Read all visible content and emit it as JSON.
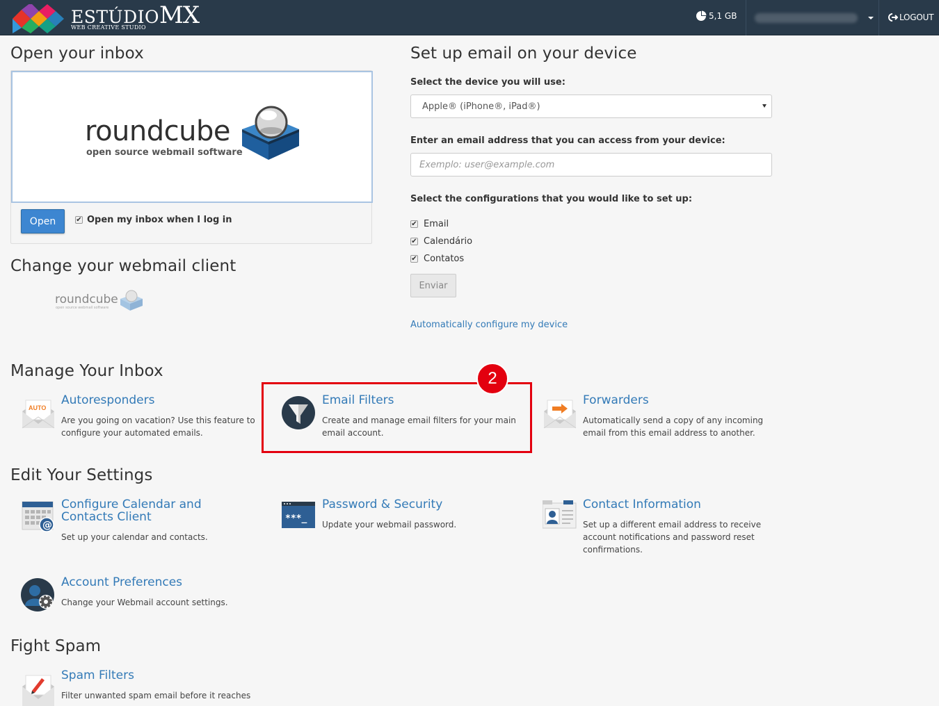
{
  "header": {
    "brand_main": "ESTÚDIO",
    "brand_mx": "MX",
    "brand_tagline": "WEB CREATIVE STUDIO",
    "disk_usage": "5,1 GB",
    "logout_label": "LOGOUT"
  },
  "inbox": {
    "title": "Open your inbox",
    "client_name": "roundcube",
    "client_tagline": "open source webmail software",
    "open_button": "Open",
    "auto_open_label": "Open my inbox when I log in"
  },
  "webmail_client": {
    "title": "Change your webmail client",
    "client_name": "roundcube",
    "client_tagline": "open source webmail software"
  },
  "device_setup": {
    "title": "Set up email on your device",
    "device_label": "Select the device you will use:",
    "device_selected": "Apple® (iPhone®, iPad®)",
    "email_label": "Enter an email address that you can access from your device:",
    "email_placeholder": "Exemplo: user@example.com",
    "configs_label": "Select the configurations that you would like to set up:",
    "configs": [
      "Email",
      "Calendário",
      "Contatos"
    ],
    "submit_button": "Enviar",
    "auto_configure_link": "Automatically configure my device"
  },
  "manage_inbox": {
    "title": "Manage Your Inbox",
    "items": [
      {
        "title": "Autoresponders",
        "desc": "Are you going on vacation? Use this feature to configure your automated emails.",
        "icon_text": "AUTO"
      },
      {
        "title": "Email Filters",
        "desc": "Create and manage email filters for your main email account."
      },
      {
        "title": "Forwarders",
        "desc": "Automatically send a copy of any incoming email from this email address to another."
      }
    ]
  },
  "settings": {
    "title": "Edit Your Settings",
    "items": [
      {
        "title": "Configure Calendar and Contacts Client",
        "desc": "Set up your calendar and contacts."
      },
      {
        "title": "Password & Security",
        "desc": "Update your webmail password.",
        "icon_text": "***_"
      },
      {
        "title": "Contact Information",
        "desc": "Set up a different email address to receive account notifications and password reset confirmations."
      },
      {
        "title": "Account Preferences",
        "desc": "Change your Webmail account settings."
      }
    ]
  },
  "spam": {
    "title": "Fight Spam",
    "items": [
      {
        "title": "Spam Filters",
        "desc": "Filter unwanted spam email before it reaches"
      }
    ]
  },
  "annotation": {
    "step_number": "2"
  },
  "colors": {
    "topbar": "#293a4a",
    "link": "#337ab7",
    "primary_button": "#3d86d1",
    "highlight": "#e3000f"
  }
}
